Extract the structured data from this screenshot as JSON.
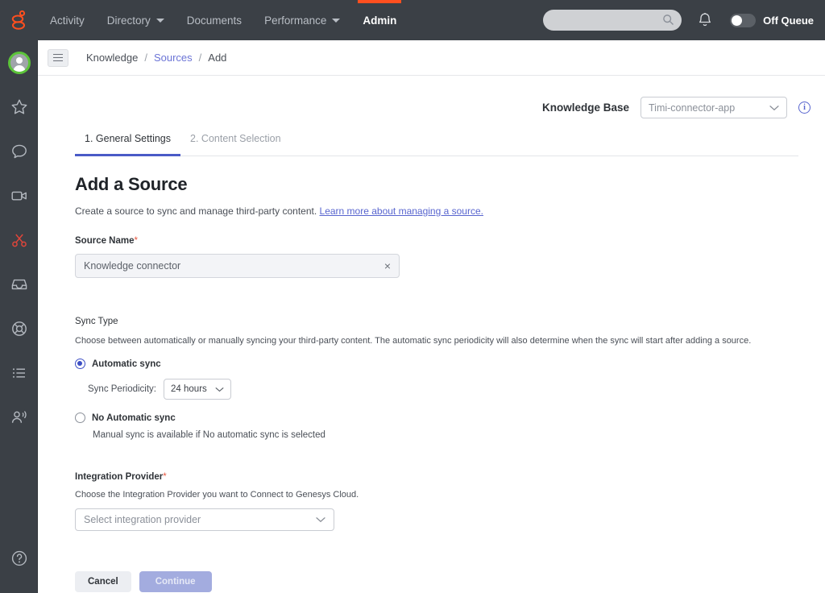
{
  "topnav": {
    "logo_name": "genesys-logo",
    "items": [
      {
        "label": "Activity",
        "has_caret": false,
        "active": false
      },
      {
        "label": "Directory",
        "has_caret": true,
        "active": false
      },
      {
        "label": "Documents",
        "has_caret": false,
        "active": false
      },
      {
        "label": "Performance",
        "has_caret": true,
        "active": false
      },
      {
        "label": "Admin",
        "has_caret": false,
        "active": true
      }
    ],
    "search": {
      "value": "",
      "placeholder": ""
    },
    "bell_icon": "notification-bell-icon",
    "queue_toggle_state": "off",
    "queue_label": "Off Queue",
    "accent_color": "#ff4f1f",
    "background_color": "#3b4046"
  },
  "left_rail": {
    "items": [
      {
        "icon": "avatar-icon",
        "status": "available"
      },
      {
        "icon": "star-icon"
      },
      {
        "icon": "chat-bubble-icon"
      },
      {
        "icon": "video-camera-icon"
      },
      {
        "icon": "scissors-icon",
        "color": "#e0453a"
      },
      {
        "icon": "inbox-tray-icon"
      },
      {
        "icon": "lifebuoy-icon"
      },
      {
        "icon": "list-icon"
      },
      {
        "icon": "person-speaking-icon"
      }
    ],
    "help_icon": "help-circle-icon",
    "status_color": "#5cc43a"
  },
  "breadcrumb": {
    "menu_icon": "hamburger-menu-icon",
    "items": [
      {
        "label": "Knowledge",
        "is_link": false
      },
      {
        "label": "Sources",
        "is_link": true
      },
      {
        "label": "Add",
        "is_link": false
      }
    ],
    "separator": "/",
    "link_color": "#6b74d6"
  },
  "knowledge_base": {
    "label": "Knowledge Base",
    "selected": "Timi-connector-app",
    "chevron_icon": "chevron-down-icon",
    "info_icon": "info-circle-icon",
    "info_glyph": "i"
  },
  "tabs": [
    {
      "label": "1. General Settings",
      "active": true
    },
    {
      "label": "2. Content Selection",
      "active": false
    }
  ],
  "active_tab_color": "#4a5bc7",
  "page": {
    "title": "Add a Source",
    "subtitle_text": "Create a source to sync and manage third-party content.",
    "subtitle_link": "Learn more about managing a source."
  },
  "source_name": {
    "label": "Source Name",
    "required_marker": "*",
    "value": "Knowledge connector",
    "placeholder": "Knowledge connector",
    "clear_icon": "clear-x-icon",
    "clear_glyph": "×"
  },
  "sync_type": {
    "title": "Sync Type",
    "description": "Choose between automatically or manually syncing your third-party content. The automatic sync periodicity will also determine when the sync will start after adding a source.",
    "options": [
      {
        "label": "Automatic sync",
        "selected": true
      },
      {
        "label": "No Automatic sync",
        "selected": false
      }
    ],
    "periodicity_label": "Sync Periodicity:",
    "periodicity_value": "24 hours",
    "periodicity_chevron": "chevron-down-icon",
    "manual_note": "Manual sync is available if No automatic sync is selected",
    "radio_color": "#3d4fc4"
  },
  "integration_provider": {
    "label": "Integration Provider",
    "required_marker": "*",
    "description": "Choose the Integration Provider you want to Connect to Genesys Cloud.",
    "select_placeholder": "Select integration provider",
    "chevron_icon": "chevron-down-icon"
  },
  "actions": {
    "cancel_label": "Cancel",
    "continue_label": "Continue",
    "continue_disabled": true
  }
}
